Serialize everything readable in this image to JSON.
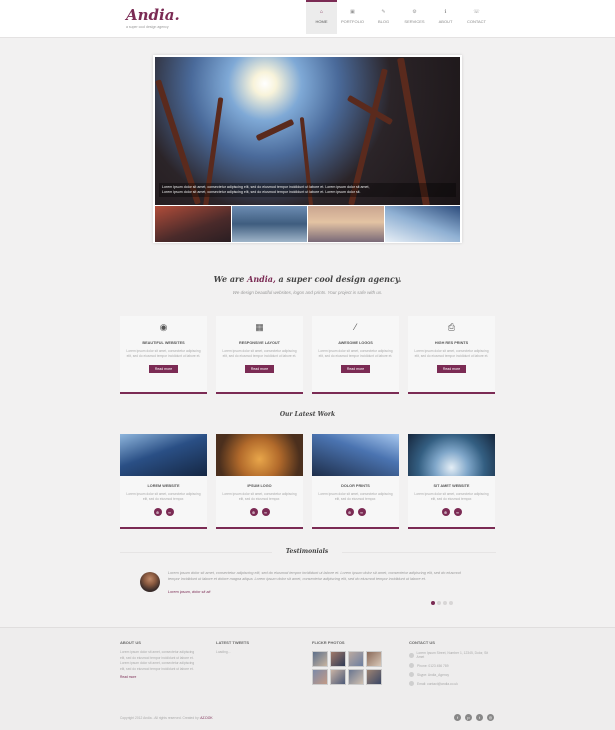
{
  "header": {
    "logo": "Andia.",
    "tagline": "a super cool design agency",
    "nav": [
      {
        "label": "HOME",
        "icon": "home-icon",
        "glyph": "⌂",
        "active": true
      },
      {
        "label": "PORTFOLIO",
        "icon": "briefcase-icon",
        "glyph": "▣",
        "active": false
      },
      {
        "label": "BLOG",
        "icon": "pencil-icon",
        "glyph": "✎",
        "active": false
      },
      {
        "label": "SERVICES",
        "icon": "wrench-icon",
        "glyph": "⚙",
        "active": false
      },
      {
        "label": "ABOUT",
        "icon": "info-icon",
        "glyph": "ℹ",
        "active": false
      },
      {
        "label": "CONTACT",
        "icon": "phone-icon",
        "glyph": "☏",
        "active": false
      }
    ]
  },
  "slider": {
    "caption_line1": "Lorem ipsum dolor sit amet, consectetur adipiscing elit, sed do eiusmod tempor incididunt ut labore et. Lorem ipsum dolor sit amet,",
    "caption_line2": "Lorem ipsum dolor sit amet, consectetur adipiscing elit, sed do eiusmod tempor incididunt ut labore et. Lorem ipsum dolor sit."
  },
  "intro": {
    "title_prefix": "We are",
    "title_brand": "Andia,",
    "title_suffix": "a super cool design agency.",
    "subtitle": "We design beautiful websites, logos and prints. Your project is safe with us."
  },
  "features": [
    {
      "title": "BEAUTIFUL WEBSITES",
      "icon": "eye-icon",
      "glyph": "◉",
      "text": "Lorem ipsum dolor sit amet, consectetur adipiscing elit, sed do eiusmod tempor incididunt ut labore et.",
      "button": "Read more"
    },
    {
      "title": "RESPONSIVE LAYOUT",
      "icon": "grid-icon",
      "glyph": "▦",
      "text": "Lorem ipsum dolor sit amet, consectetur adipiscing elit, sed do eiusmod tempor incididunt ut labore et.",
      "button": "Read more"
    },
    {
      "title": "AWESOME LOGOS",
      "icon": "magic-wand-icon",
      "glyph": "⁄",
      "text": "Lorem ipsum dolor sit amet, consectetur adipiscing elit, sed do eiusmod tempor incididunt ut labore et.",
      "button": "Read more"
    },
    {
      "title": "HIGH RES PRINTS",
      "icon": "printer-icon",
      "glyph": "⎙",
      "text": "Lorem ipsum dolor sit amet, consectetur adipiscing elit, sed do eiusmod tempor incididunt ut labore et.",
      "button": "Read more"
    }
  ],
  "latest_work": {
    "heading": "Our Latest Work",
    "items": [
      {
        "title": "LOREM WEBSITE",
        "text": "Lorem ipsum dolor sit amet, consectetur adipiscing elit, sed do eiusmod tempor."
      },
      {
        "title": "IPSUM LOGO",
        "text": "Lorem ipsum dolor sit amet, consectetur adipiscing elit, sed do eiusmod tempor."
      },
      {
        "title": "DOLOR PRINTS",
        "text": "Lorem ipsum dolor sit amet, consectetur adipiscing elit, sed do eiusmod tempor."
      },
      {
        "title": "SIT AMET WEBSITE",
        "text": "Lorem ipsum dolor sit amet, consectetur adipiscing elit, sed do eiusmod tempor."
      }
    ]
  },
  "testimonials": {
    "heading": "Testimonials",
    "text": "Lorem ipsum dolor sit amet, consectetur adipiscing elit, sed do eiusmod tempor incididunt ut labore et. Lorem ipsum dolor sit amet, consectetur adipiscing elit, sed do eiusmod tempor incididunt ut labore et dolore magna aliqua. Lorem ipsum dolor sit amet, consectetur adipiscing elit, sed do eiusmod tempor incididunt ut labore et.",
    "author": "Lorem ipsum, dolor sit ait"
  },
  "footer": {
    "about": {
      "heading": "ABOUT US",
      "text": "Lorem ipsum dolor sit amet, consectetur adipiscing elit, sed do eiusmod tempor incididunt ut labore et. Lorem ipsum dolor sit amet, consectetur adipiscing elit, sed do eiusmod tempor incididunt ut labore et.",
      "link": "Read more"
    },
    "tweets": {
      "heading": "LATEST TWEETS",
      "text": "Loading..."
    },
    "flickr": {
      "heading": "FLICKR PHOTOS"
    },
    "contact": {
      "heading": "CONTACT US",
      "rows": [
        "Lorem Ipsum Street, Number 1, 12345, Dolor, Sit Amet",
        "Phone: 0123 456 789",
        "Skype: Andia_Agency",
        "Email: contact@andia.co.uk"
      ]
    },
    "copyright_text": "Copyright 2012 Andia - All rights reserved. Created by:",
    "copyright_brand": "AZ.DOK",
    "social": [
      {
        "icon": "facebook-icon",
        "glyph": "f"
      },
      {
        "icon": "pinterest-icon",
        "glyph": "p"
      },
      {
        "icon": "twitter-icon",
        "glyph": "t"
      },
      {
        "icon": "dribbble-icon",
        "glyph": "◎"
      }
    ]
  },
  "colors": {
    "accent": "#7b2b54",
    "background": "#f2f1f1",
    "header_bg": "#ffffff",
    "card_bg": "#f7f7f7"
  }
}
